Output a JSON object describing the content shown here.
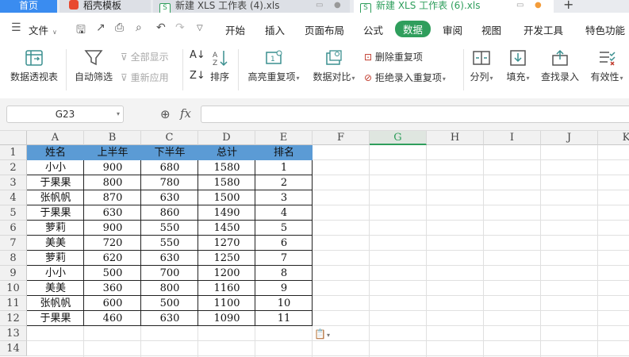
{
  "tabs": {
    "home": "首页",
    "daoke": "稻壳模板",
    "file1": "新建 XLS 工作表 (4).xls",
    "file2": "新建 XLS 工作表 (6).xls",
    "new_tab": "+"
  },
  "menu": {
    "file": "文件",
    "items": [
      "开始",
      "插入",
      "页面布局",
      "公式",
      "数据",
      "审阅",
      "视图",
      "开发工具",
      "特色功能"
    ],
    "active": "数据"
  },
  "ribbon": {
    "pivot": "数据透视表",
    "autofilter": "自动筛选",
    "show_all": "全部显示",
    "reapply": "重新应用",
    "sort": "排序",
    "highlight_dup": "高亮重复项",
    "compare": "数据对比",
    "remove_dup": "删除重复项",
    "reject_dup": "拒绝录入重复项",
    "split": "分列",
    "fill": "填充",
    "lookup": "查找录入",
    "validity": "有效性"
  },
  "formula_bar": {
    "name_box": "G23",
    "fx": "fx",
    "formula": ""
  },
  "sheet": {
    "columns": [
      "A",
      "B",
      "C",
      "D",
      "E",
      "F",
      "G",
      "H",
      "I",
      "J",
      "K"
    ],
    "selected_column": "G",
    "rows": [
      "1",
      "2",
      "3",
      "4",
      "5",
      "6",
      "7",
      "8",
      "9",
      "10",
      "11",
      "12",
      "13",
      "14"
    ],
    "header_fill": "#5b9bd5",
    "table": [
      [
        "姓名",
        "上半年",
        "下半年",
        "总计",
        "排名"
      ],
      [
        "小小",
        "900",
        "680",
        "1580",
        "1"
      ],
      [
        "于果果",
        "800",
        "780",
        "1580",
        "2"
      ],
      [
        "张帆帆",
        "870",
        "630",
        "1500",
        "3"
      ],
      [
        "于果果",
        "630",
        "860",
        "1490",
        "4"
      ],
      [
        "萝莉",
        "900",
        "550",
        "1450",
        "5"
      ],
      [
        "美美",
        "720",
        "550",
        "1270",
        "6"
      ],
      [
        "萝莉",
        "620",
        "630",
        "1250",
        "7"
      ],
      [
        "小小",
        "500",
        "700",
        "1200",
        "8"
      ],
      [
        "美美",
        "360",
        "800",
        "1160",
        "9"
      ],
      [
        "张帆帆",
        "600",
        "500",
        "1100",
        "10"
      ],
      [
        "于果果",
        "460",
        "630",
        "1090",
        "11"
      ]
    ]
  },
  "accent": "#2f9e5c"
}
